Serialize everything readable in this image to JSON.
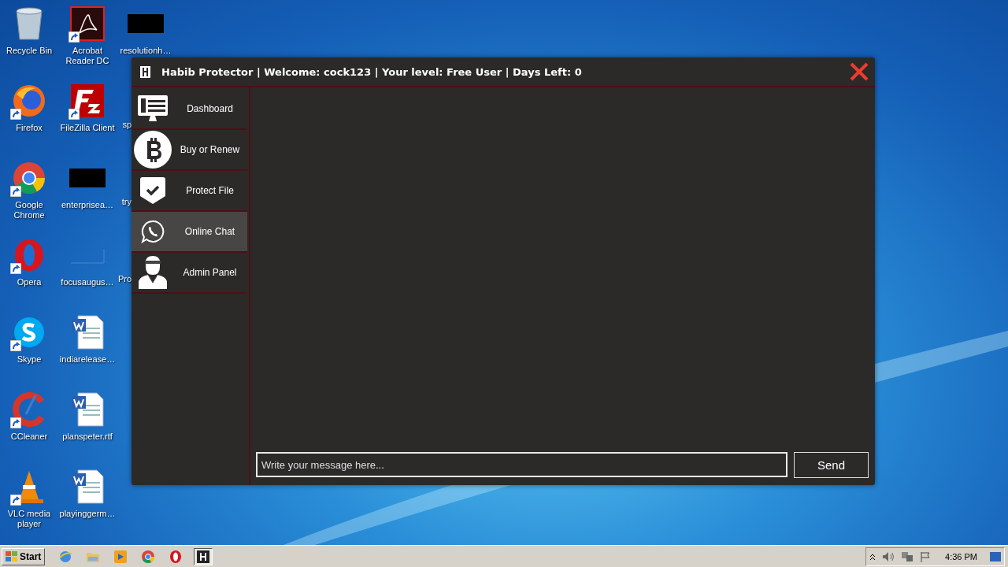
{
  "desktop": {
    "columns": [
      [
        {
          "label": "Recycle Bin",
          "shortcut": false
        },
        {
          "label": "Firefox",
          "shortcut": true
        },
        {
          "label": "Google Chrome",
          "shortcut": true
        },
        {
          "label": "Opera",
          "shortcut": true
        },
        {
          "label": "Skype",
          "shortcut": true
        },
        {
          "label": "CCleaner",
          "shortcut": true
        },
        {
          "label": "VLC media player",
          "shortcut": true
        }
      ],
      [
        {
          "label": "Acrobat Reader DC",
          "shortcut": true
        },
        {
          "label": "FileZilla Client",
          "shortcut": true
        },
        {
          "label": "enterprisea…",
          "shortcut": false
        },
        {
          "label": "focusaugus…",
          "shortcut": false
        },
        {
          "label": "indiarelease…",
          "shortcut": false
        },
        {
          "label": "planspeter.rtf",
          "shortcut": false
        },
        {
          "label": "playinggerm…",
          "shortcut": false
        }
      ],
      [
        {
          "label": "resolutionh…",
          "shortcut": false
        },
        {
          "label": "sp",
          "shortcut": false
        },
        {
          "label": "try",
          "shortcut": false
        },
        {
          "label": "Pro",
          "shortcut": false
        }
      ]
    ]
  },
  "window": {
    "title": "Habib Protector | Welcome: cock123 | Your level: Free User | Days Left: 0"
  },
  "sidebar": {
    "items": [
      {
        "label": "Dashboard",
        "selected": false
      },
      {
        "label": "Buy or Renew",
        "selected": false
      },
      {
        "label": "Protect File",
        "selected": false
      },
      {
        "label": "Online Chat",
        "selected": true
      },
      {
        "label": "Admin Panel",
        "selected": false
      }
    ]
  },
  "chat": {
    "input": {
      "placeholder": "Write your message here..."
    },
    "send_button": "Send"
  },
  "taskbar": {
    "start": "Start",
    "apps": [
      {
        "selected": false
      },
      {
        "selected": false
      },
      {
        "selected": false
      },
      {
        "selected": false
      },
      {
        "selected": false
      },
      {
        "selected": true
      }
    ],
    "clock": "4:36 PM"
  }
}
